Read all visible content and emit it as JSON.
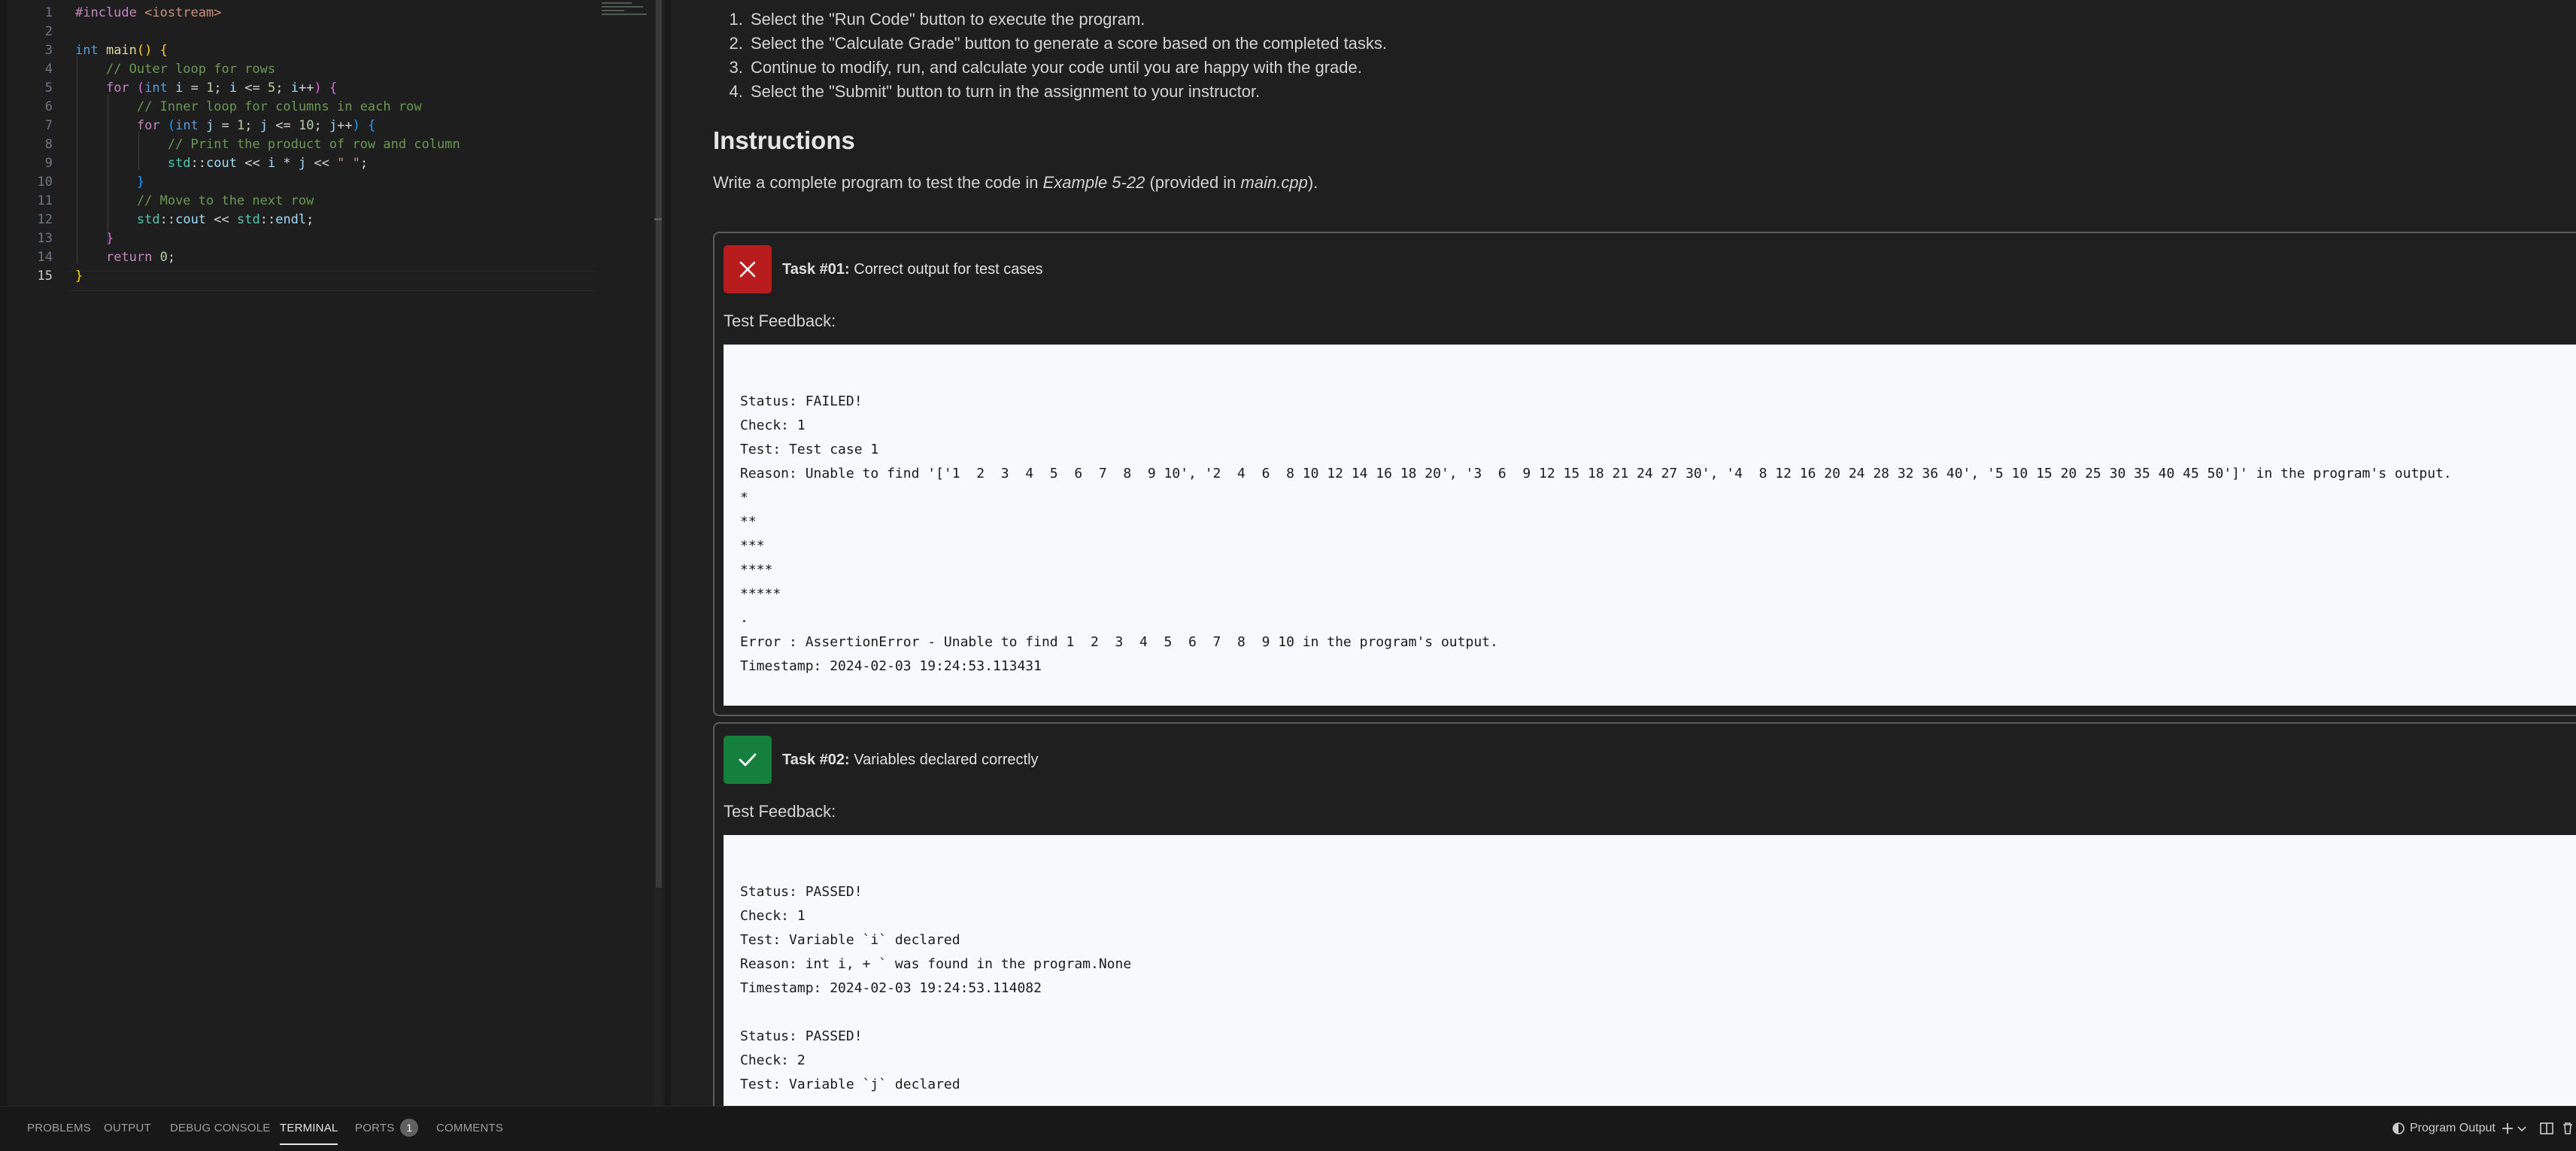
{
  "editor": {
    "lines": [
      {
        "n": "1",
        "segs": [
          [
            "pp",
            "#include "
          ],
          [
            "str",
            "<iostream>"
          ]
        ]
      },
      {
        "n": "2",
        "segs": []
      },
      {
        "n": "3",
        "segs": [
          [
            "kw",
            "int "
          ],
          [
            "fn",
            "main"
          ],
          [
            "br1",
            "() {"
          ]
        ]
      },
      {
        "n": "4",
        "segs": [
          [
            "op",
            "    "
          ],
          [
            "cm",
            "// Outer loop for rows"
          ]
        ]
      },
      {
        "n": "5",
        "segs": [
          [
            "op",
            "    "
          ],
          [
            "ctl",
            "for "
          ],
          [
            "br2",
            "("
          ],
          [
            "kw",
            "int "
          ],
          [
            "id",
            "i"
          ],
          [
            "op",
            " = "
          ],
          [
            "num",
            "1"
          ],
          [
            "op",
            "; "
          ],
          [
            "id",
            "i"
          ],
          [
            "op",
            " <= "
          ],
          [
            "num",
            "5"
          ],
          [
            "op",
            "; "
          ],
          [
            "id",
            "i"
          ],
          [
            "op",
            "++"
          ],
          [
            "br2",
            ") {"
          ]
        ]
      },
      {
        "n": "6",
        "segs": [
          [
            "op",
            "        "
          ],
          [
            "cm",
            "// Inner loop for columns in each row"
          ]
        ]
      },
      {
        "n": "7",
        "segs": [
          [
            "op",
            "        "
          ],
          [
            "ctl",
            "for "
          ],
          [
            "br3",
            "("
          ],
          [
            "kw",
            "int "
          ],
          [
            "id",
            "j"
          ],
          [
            "op",
            " = "
          ],
          [
            "num",
            "1"
          ],
          [
            "op",
            "; "
          ],
          [
            "id",
            "j"
          ],
          [
            "op",
            " <= "
          ],
          [
            "num",
            "10"
          ],
          [
            "op",
            "; "
          ],
          [
            "id",
            "j"
          ],
          [
            "op",
            "++"
          ],
          [
            "br3",
            ") {"
          ]
        ]
      },
      {
        "n": "8",
        "segs": [
          [
            "op",
            "            "
          ],
          [
            "cm",
            "// Print the product of row and column"
          ]
        ]
      },
      {
        "n": "9",
        "segs": [
          [
            "op",
            "            "
          ],
          [
            "ns",
            "std"
          ],
          [
            "op",
            "::"
          ],
          [
            "id",
            "cout"
          ],
          [
            "op",
            " << "
          ],
          [
            "id",
            "i"
          ],
          [
            "op",
            " * "
          ],
          [
            "id",
            "j"
          ],
          [
            "op",
            " << "
          ],
          [
            "str",
            "\" \""
          ],
          [
            "op",
            ";"
          ]
        ]
      },
      {
        "n": "10",
        "segs": [
          [
            "op",
            "        "
          ],
          [
            "br3",
            "}"
          ]
        ]
      },
      {
        "n": "11",
        "segs": [
          [
            "op",
            "        "
          ],
          [
            "cm",
            "// Move to the next row"
          ]
        ]
      },
      {
        "n": "12",
        "segs": [
          [
            "op",
            "        "
          ],
          [
            "ns",
            "std"
          ],
          [
            "op",
            "::"
          ],
          [
            "id",
            "cout"
          ],
          [
            "op",
            " << "
          ],
          [
            "ns",
            "std"
          ],
          [
            "op",
            "::"
          ],
          [
            "id",
            "endl"
          ],
          [
            "op",
            ";"
          ]
        ]
      },
      {
        "n": "13",
        "segs": [
          [
            "op",
            "    "
          ],
          [
            "br2",
            "}"
          ]
        ]
      },
      {
        "n": "14",
        "segs": [
          [
            "op",
            "    "
          ],
          [
            "ctl",
            "return "
          ],
          [
            "num",
            "0"
          ],
          [
            "op",
            ";"
          ]
        ]
      },
      {
        "n": "15",
        "segs": [
          [
            "br1",
            "}"
          ]
        ]
      }
    ]
  },
  "instructions": {
    "steps": [
      "Select the \"Run Code\" button to execute the program.",
      "Select the \"Calculate Grade\" button to generate a score based on the completed tasks.",
      "Continue to modify, run, and calculate your code until you are happy with the grade.",
      "Select the \"Submit\" button to turn in the assignment to your instructor."
    ],
    "title": "Instructions",
    "intro_prefix": "Write a complete program to test the code in ",
    "intro_example": "Example 5-22",
    "intro_middle": " (provided in ",
    "intro_file": "main.cpp",
    "intro_suffix": ")."
  },
  "tasks": [
    {
      "number": "Task #01:",
      "title": " Correct output for test cases",
      "status": "fail",
      "feedback_label": "Test Feedback:",
      "feedback_lines": [
        "",
        "Status: FAILED!",
        "Check: 1",
        "Test: Test case 1",
        "Reason: Unable to find '['1  2  3  4  5  6  7  8  9 10', '2  4  6  8 10 12 14 16 18 20', '3  6  9 12 15 18 21 24 27 30', '4  8 12 16 20 24 28 32 36 40', '5 10 15 20 25 30 35 40 45 50']' in the program's output.",
        "*",
        "**",
        "***",
        "****",
        "*****",
        ".",
        "Error : AssertionError - Unable to find 1  2  3  4  5  6  7  8  9 10 in the program's output.",
        "Timestamp: 2024-02-03 19:24:53.113431"
      ]
    },
    {
      "number": "Task #02:",
      "title": " Variables declared correctly",
      "status": "pass",
      "feedback_label": "Test Feedback:",
      "feedback_lines": [
        "",
        "Status: PASSED!",
        "Check: 1",
        "Test: Variable `i` declared",
        "Reason: int i, + ` was found in the program.None",
        "Timestamp: 2024-02-03 19:24:53.114082",
        "",
        "Status: PASSED!",
        "Check: 2",
        "Test: Variable `j` declared"
      ]
    }
  ],
  "bottom_panel": {
    "tabs": [
      "PROBLEMS",
      "OUTPUT",
      "DEBUG CONSOLE",
      "TERMINAL",
      "PORTS",
      "COMMENTS"
    ],
    "active_tab": "TERMINAL",
    "ports_badge": "1",
    "terminal_select": "Program Output"
  }
}
